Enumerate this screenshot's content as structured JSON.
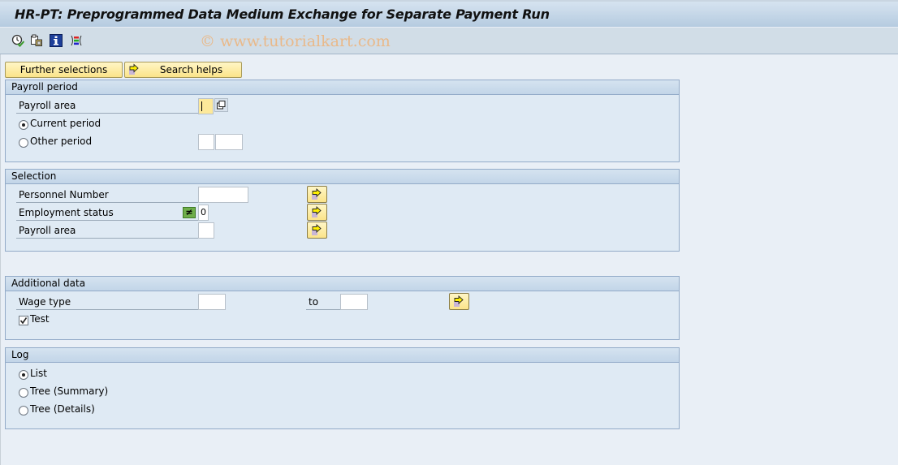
{
  "window": {
    "title": "HR-PT: Preprogrammed Data Medium Exchange for Separate Payment Run",
    "watermark": "© www.tutorialkart.com"
  },
  "toolbar": {
    "icons": [
      "execute-icon",
      "copy-variant-icon",
      "information-icon",
      "selection-options-icon"
    ]
  },
  "buttons": {
    "further_selections": "Further selections",
    "search_helps": "Search helps"
  },
  "payroll_period": {
    "header": "Payroll period",
    "payroll_area_label": "Payroll area",
    "payroll_area_value": "",
    "current_period_label": "Current period",
    "current_period_selected": true,
    "other_period_label": "Other period",
    "other_period_selected": false,
    "other_period_value1": "",
    "other_period_value2": ""
  },
  "selection": {
    "header": "Selection",
    "personnel_number_label": "Personnel Number",
    "personnel_number_value": "",
    "employment_status_label": "Employment status",
    "employment_status_option": "≠",
    "employment_status_value": "0",
    "payroll_area_label": "Payroll area",
    "payroll_area_value": ""
  },
  "additional_data": {
    "header": "Additional data",
    "wage_type_label": "Wage type",
    "wage_type_from": "",
    "to_label": "to",
    "wage_type_to": "",
    "test_label": "Test",
    "test_checked": true
  },
  "log": {
    "header": "Log",
    "options": [
      {
        "label": "List",
        "selected": true
      },
      {
        "label": "Tree (Summary)",
        "selected": false
      },
      {
        "label": "Tree (Details)",
        "selected": false
      }
    ]
  }
}
